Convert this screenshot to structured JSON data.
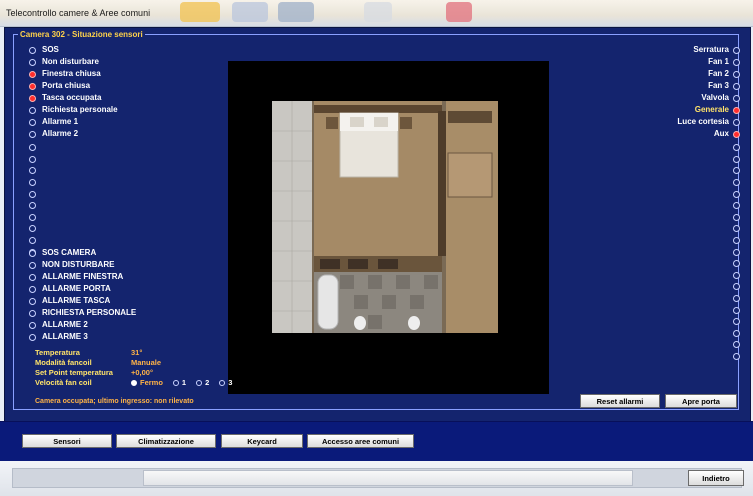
{
  "window": {
    "title": "Telecontrollo camere & Aree comuni"
  },
  "panel": {
    "legend": "Camera 302 - Situazione sensori"
  },
  "sensors_left": [
    {
      "label": "SOS",
      "on": false
    },
    {
      "label": "Non disturbare",
      "on": false
    },
    {
      "label": "Finestra chiusa",
      "on": true
    },
    {
      "label": "Porta chiusa",
      "on": true
    },
    {
      "label": "Tasca occupata",
      "on": true
    },
    {
      "label": "Richiesta personale",
      "on": false
    },
    {
      "label": "Allarme 1",
      "on": false
    },
    {
      "label": "Allarme 2",
      "on": false
    }
  ],
  "sensors_right": [
    {
      "label": "Serratura",
      "on": false
    },
    {
      "label": "Fan 1",
      "on": false
    },
    {
      "label": "Fan 2",
      "on": false
    },
    {
      "label": "Fan 3",
      "on": false
    },
    {
      "label": "Valvola",
      "on": false
    },
    {
      "label": "Generale",
      "on": true
    },
    {
      "label": "Luce cortesia",
      "on": false
    },
    {
      "label": "Aux",
      "on": true
    }
  ],
  "alarms_left": [
    {
      "label": "SOS CAMERA",
      "on": false
    },
    {
      "label": "NON DISTURBARE",
      "on": false
    },
    {
      "label": "ALLARME FINESTRA",
      "on": false
    },
    {
      "label": "ALLARME PORTA",
      "on": false
    },
    {
      "label": "ALLARME TASCA",
      "on": false
    },
    {
      "label": "RICHIESTA PERSONALE",
      "on": false
    },
    {
      "label": "ALLARME 2",
      "on": false
    },
    {
      "label": "ALLARME 3",
      "on": false
    }
  ],
  "climate": {
    "temp_label": "Temperatura",
    "temp_value": "31°",
    "mode_label": "Modalità fancoil",
    "mode_value": "Manuale",
    "setpoint_label": "Set Point temperatura",
    "setpoint_value": "+0,00°",
    "fan_label": "Velocità fan coil",
    "fan_options": [
      {
        "label": "Fermo",
        "on": true
      },
      {
        "label": "1",
        "on": false
      },
      {
        "label": "2",
        "on": false
      },
      {
        "label": "3",
        "on": false
      }
    ]
  },
  "status_text": "Camera occupata; ultimo ingresso: non rilevato",
  "buttons": {
    "reset_alarms": "Reset allarmi",
    "open_door": "Apre porta"
  },
  "nav": {
    "sensors": "Sensori",
    "climate": "Climatizzazione",
    "keycard": "Keycard",
    "common_areas": "Accesso aree comuni"
  },
  "footer": {
    "back": "Indietro"
  },
  "colors": {
    "panel_bg": "#14246e",
    "nav_bg": "#0a1a7a",
    "label_yellow": "#ffe36a",
    "value_orange": "#ffb347",
    "active_red": "#ff2d2d"
  }
}
